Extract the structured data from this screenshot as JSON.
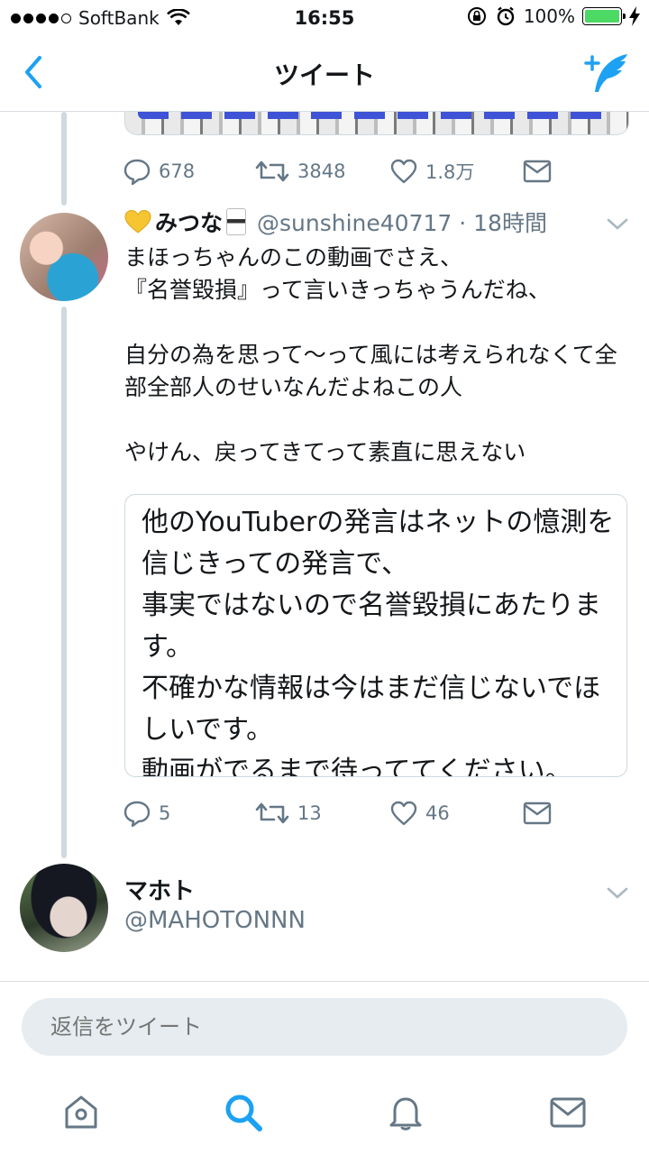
{
  "status_bar": {
    "carrier": "SoftBank",
    "time": "16:55",
    "battery": "100%",
    "battery_level": 1.0
  },
  "nav": {
    "title": "ツイート",
    "back_icon": "chevron-left-icon",
    "compose_icon": "compose-tweet-icon"
  },
  "previous_tweet": {
    "actions": {
      "replies": "678",
      "retweets": "3848",
      "likes": "1.8万"
    }
  },
  "tweet": {
    "display_name": "みつな",
    "handle_time": "@sunshine40717 · 18時間",
    "text": "まほっちゃんのこの動画でさえ、\n『名誉毀損』って言いきっちゃうんだね、\n\n自分の為を思って〜って風には考えられなくて全部全部人のせいなんだよねこの人\n\nやけん、戻ってきてって素直に思えない",
    "quote": "他のYouTuberの発言はネットの憶測を信じきっての発言で、\n事実ではないので名誉毀損にあたります。\n不確かな情報は今はまだ信じないでほしいです。\n動画がでるまで待っててください。",
    "actions": {
      "replies": "5",
      "retweets": "13",
      "likes": "46"
    }
  },
  "next_tweet": {
    "display_name": "マホト",
    "handle": "@MAHOTONNN"
  },
  "reply": {
    "placeholder": "返信をツイート"
  },
  "tabbar": {
    "items": [
      "home-icon",
      "search-icon",
      "notifications-icon",
      "messages-icon"
    ],
    "active": "search-icon"
  },
  "colors": {
    "accent": "#1da1f2",
    "muted": "#657786",
    "thread_line": "#cfd9de",
    "battery": "#4cd964"
  }
}
